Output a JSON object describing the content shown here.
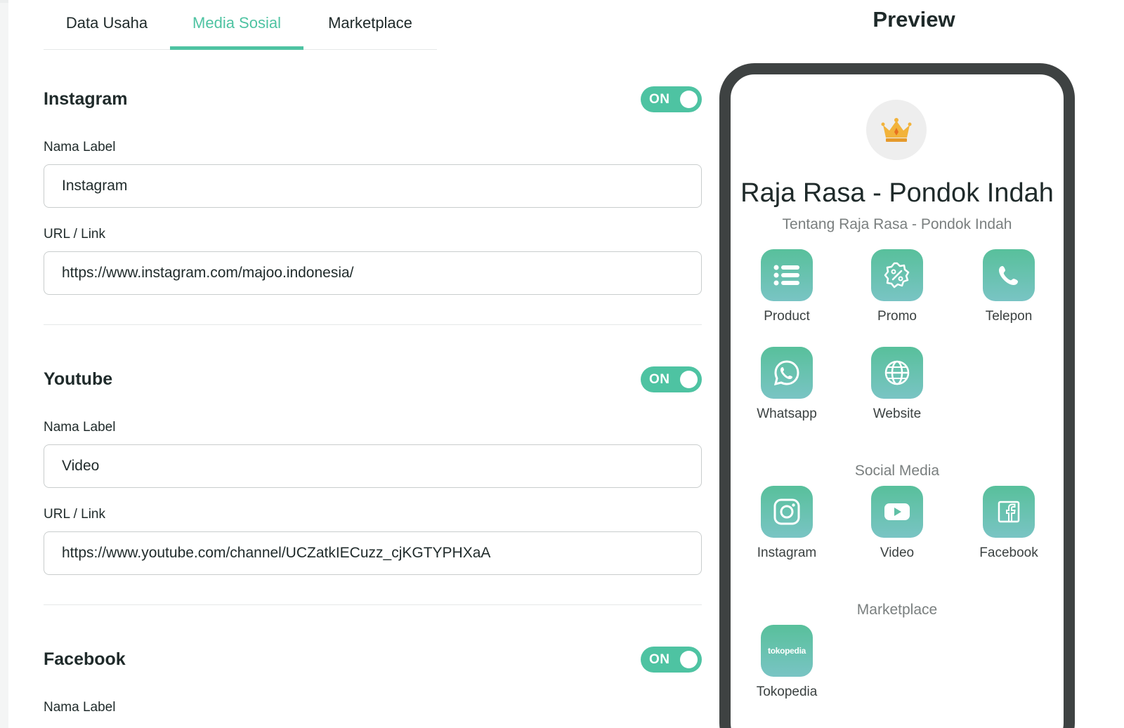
{
  "tabs": [
    {
      "label": "Data Usaha",
      "active": false
    },
    {
      "label": "Media Sosial",
      "active": true
    },
    {
      "label": "Marketplace",
      "active": false
    }
  ],
  "sections": {
    "instagram": {
      "title": "Instagram",
      "toggle": "ON",
      "name_label": "Nama Label",
      "name_value": "Instagram",
      "url_label": "URL / Link",
      "url_value": "https://www.instagram.com/majoo.indonesia/"
    },
    "youtube": {
      "title": "Youtube",
      "toggle": "ON",
      "name_label": "Nama Label",
      "name_value": "Video",
      "url_label": "URL / Link",
      "url_value": "https://www.youtube.com/channel/UCZatkIECuzz_cjKGTYPHXaA"
    },
    "facebook": {
      "title": "Facebook",
      "toggle": "ON",
      "name_label": "Nama Label"
    }
  },
  "preview": {
    "title": "Preview",
    "store_name": "Raja Rasa - Pondok Indah",
    "store_about": "Tentang Raja Rasa - Pondok Indah",
    "logo_icon": "crown-icon",
    "main_apps": [
      {
        "label": "Product",
        "icon": "list-icon"
      },
      {
        "label": "Promo",
        "icon": "discount-icon"
      },
      {
        "label": "Telepon",
        "icon": "phone-icon"
      },
      {
        "label": "Whatsapp",
        "icon": "whatsapp-icon"
      },
      {
        "label": "Website",
        "icon": "globe-icon"
      }
    ],
    "social_title": "Social Media",
    "social_apps": [
      {
        "label": "Instagram",
        "icon": "instagram-icon"
      },
      {
        "label": "Video",
        "icon": "youtube-icon"
      },
      {
        "label": "Facebook",
        "icon": "facebook-icon"
      }
    ],
    "marketplace_title": "Marketplace",
    "marketplace_apps": [
      {
        "label": "Tokopedia",
        "icon": "tokopedia-icon",
        "icon_text": "tokopedia"
      }
    ]
  },
  "colors": {
    "accent": "#4ec3a2",
    "phone_frame": "#3e4242",
    "icon_gradient_top": "#58c09b",
    "icon_gradient_bottom": "#79c4c4"
  }
}
